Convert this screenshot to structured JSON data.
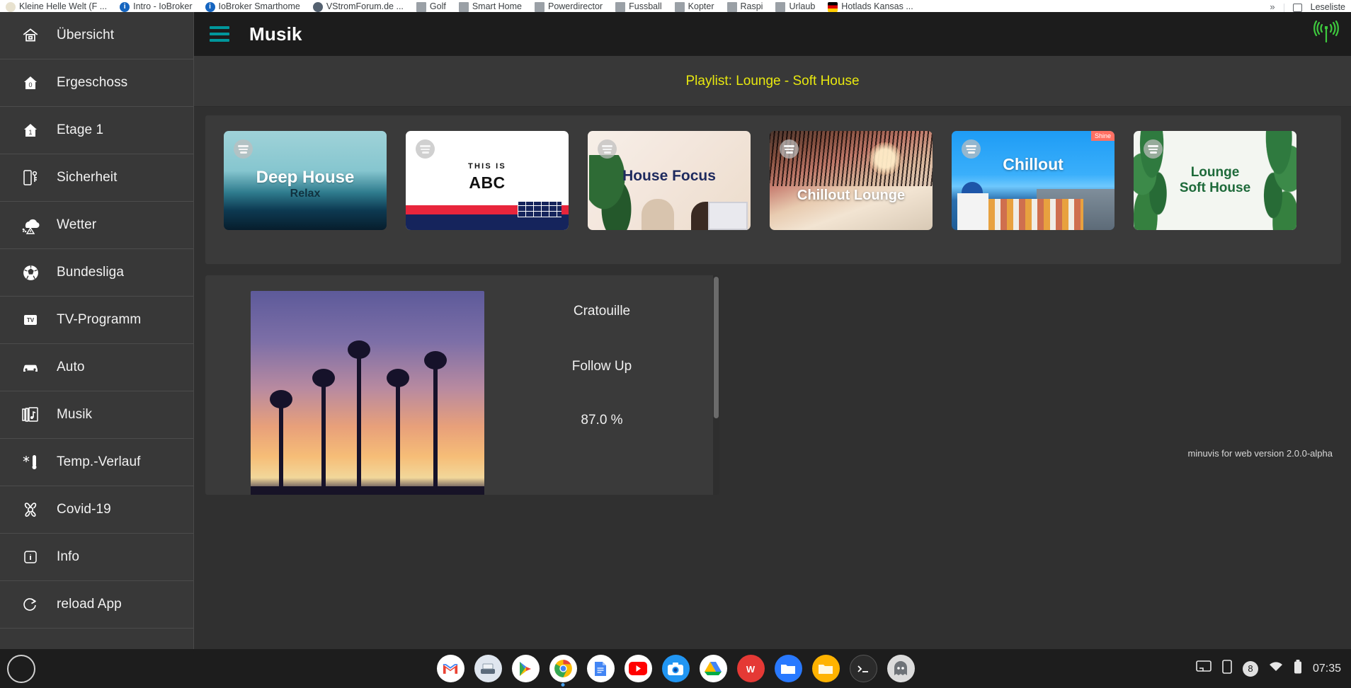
{
  "browser": {
    "bookmarks": [
      {
        "label": "Kleine Helle Welt (F ...",
        "icon": "cream"
      },
      {
        "label": "Intro - IoBroker",
        "icon": "blue"
      },
      {
        "label": "IoBroker Smarthome",
        "icon": "blue"
      },
      {
        "label": "VStromForum.de  ...",
        "icon": "dark"
      },
      {
        "label": "Golf",
        "icon": "grey"
      },
      {
        "label": "Smart Home",
        "icon": "grey"
      },
      {
        "label": "Powerdirector",
        "icon": "grey"
      },
      {
        "label": "Fussball",
        "icon": "grey"
      },
      {
        "label": "Kopter",
        "icon": "grey"
      },
      {
        "label": "Raspi",
        "icon": "grey"
      },
      {
        "label": "Urlaub",
        "icon": "grey"
      },
      {
        "label": "Hotlads Kansas  ...",
        "icon": "flag"
      }
    ],
    "overflow_label": "»",
    "reading_list_label": "Leseliste"
  },
  "sidebar": {
    "items": [
      {
        "label": "Übersicht",
        "icon": "home-overview-icon"
      },
      {
        "label": "Ergeschoss",
        "icon": "house-floor-0-icon"
      },
      {
        "label": "Etage 1",
        "icon": "house-floor-1-icon"
      },
      {
        "label": "Sicherheit",
        "icon": "door-key-icon"
      },
      {
        "label": "Wetter",
        "icon": "cloud-weather-icon"
      },
      {
        "label": "Bundesliga",
        "icon": "soccer-ball-icon"
      },
      {
        "label": "TV-Programm",
        "icon": "tv-icon"
      },
      {
        "label": "Auto",
        "icon": "car-icon"
      },
      {
        "label": "Musik",
        "icon": "music-library-icon"
      },
      {
        "label": "Temp.-Verlauf",
        "icon": "thermometer-snowflake-icon"
      },
      {
        "label": "Covid-19",
        "icon": "biohazard-icon"
      },
      {
        "label": "Info",
        "icon": "info-icon"
      },
      {
        "label": "reload App",
        "icon": "reload-icon"
      }
    ]
  },
  "header": {
    "title": "Musik",
    "menu_icon": "hamburger-menu-icon",
    "status_icon": "broadcast-antenna-icon",
    "menu_color": "#00979c",
    "status_color": "#3ec93e"
  },
  "playlist_bar": {
    "text": "Playlist: Lounge - Soft House",
    "color": "#e8e80f"
  },
  "covers": [
    {
      "title": "Deep House",
      "subtitle": "Relax",
      "badge": "",
      "source_icon": "spotify-icon"
    },
    {
      "title": "ABC",
      "subtitle": "THIS IS",
      "badge": "",
      "source_icon": "spotify-icon"
    },
    {
      "title": "House Focus",
      "subtitle": "",
      "badge": "",
      "source_icon": "spotify-icon"
    },
    {
      "title": "Chillout Lounge",
      "subtitle": "",
      "badge": "",
      "source_icon": "spotify-icon"
    },
    {
      "title": "Chillout",
      "subtitle": "",
      "badge": "Shine",
      "source_icon": "spotify-icon"
    },
    {
      "title": "Lounge\nSoft House",
      "subtitle": "",
      "badge": "",
      "source_icon": "spotify-icon"
    }
  ],
  "now_playing": {
    "track": "Cratouille",
    "artist": "Follow Up",
    "volume": "87.0 %",
    "artwork": "palm-trees-sunset"
  },
  "footer": {
    "version": "minuvis for web version 2.0.0-alpha"
  },
  "taskbar": {
    "home_icon": "circle-home-icon",
    "apps": [
      {
        "name": "gmail-icon"
      },
      {
        "name": "scanner-icon"
      },
      {
        "name": "play-store-icon"
      },
      {
        "name": "chrome-icon"
      },
      {
        "name": "docs-icon"
      },
      {
        "name": "youtube-icon"
      },
      {
        "name": "camera-icon"
      },
      {
        "name": "drive-icon"
      },
      {
        "name": "wps-office-icon"
      },
      {
        "name": "files-icon"
      },
      {
        "name": "folder-icon"
      },
      {
        "name": "terminal-icon"
      },
      {
        "name": "ghost-app-icon"
      }
    ],
    "status": {
      "cast_icon": "cast-icon",
      "device_icon": "tablet-icon",
      "notification_count": "8",
      "wifi_icon": "wifi-icon",
      "battery_icon": "battery-icon",
      "clock": "07:35"
    }
  }
}
